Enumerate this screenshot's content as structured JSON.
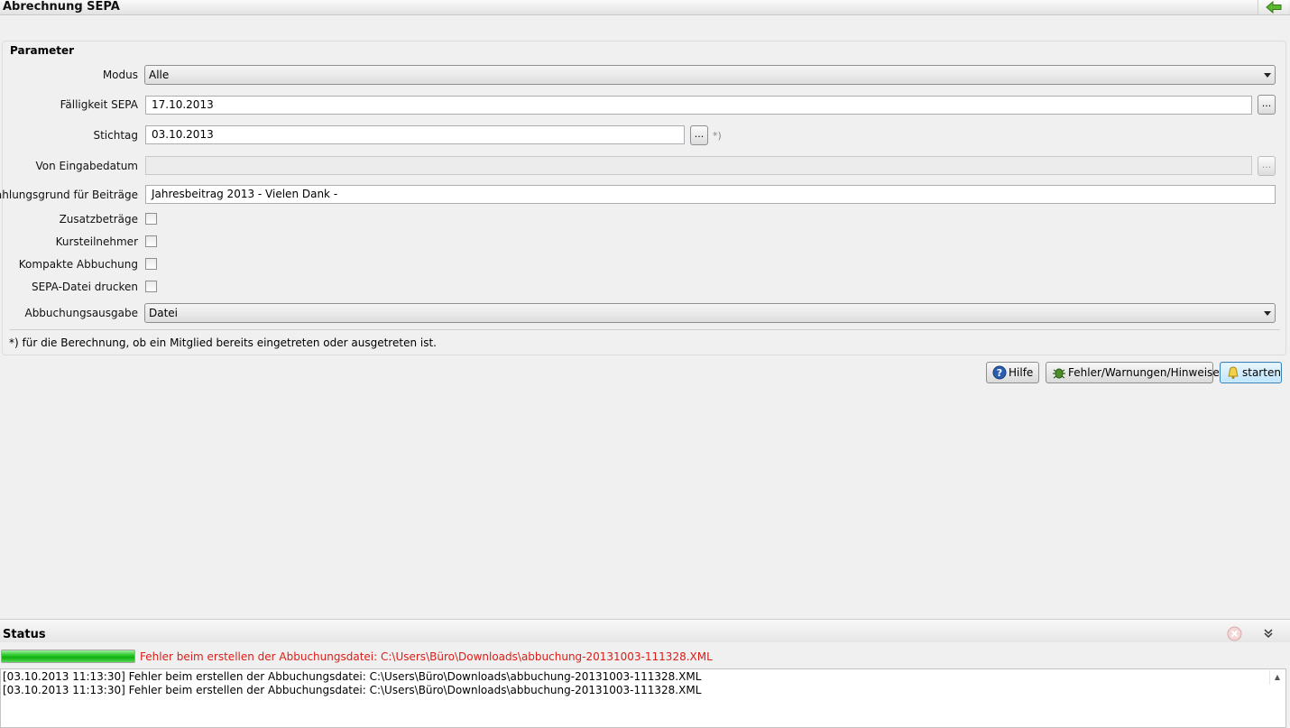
{
  "window": {
    "title": "Abrechnung SEPA",
    "back_icon": "arrow-left-icon"
  },
  "parameter": {
    "title": "Parameter",
    "modus": {
      "label": "Modus",
      "value": "Alle"
    },
    "faelligkeit": {
      "label": "Fälligkeit SEPA",
      "value": "17.10.2013",
      "button": "..."
    },
    "stichtag": {
      "label": "Stichtag",
      "value": "03.10.2013",
      "button": "...",
      "hint": "*)"
    },
    "von_eingabedatum": {
      "label": "Von Eingabedatum",
      "value": "",
      "button": "..."
    },
    "zahlungsgrund": {
      "label": "Zahlungsgrund für Beiträge",
      "value": "Jahresbeitrag 2013 -  Vielen Dank -"
    },
    "checkboxes": [
      {
        "label": "Zusatzbeträge",
        "checked": false
      },
      {
        "label": "Kursteilnehmer",
        "checked": false
      },
      {
        "label": "Kompakte Abbuchung",
        "checked": false
      },
      {
        "label": "SEPA-Datei drucken",
        "checked": false
      }
    ],
    "abbuchungsausgabe": {
      "label": "Abbuchungsausgabe",
      "value": "Datei"
    },
    "footnote": "*) für die Berechnung, ob ein Mitglied bereits eingetreten oder ausgetreten ist."
  },
  "actions": {
    "hilfe": "Hilfe",
    "fehler": "Fehler/Warnungen/Hinweise",
    "starten": "starten"
  },
  "status": {
    "title": "Status",
    "progress": 1.0,
    "message": "Fehler beim erstellen der Abbuchungsdatei: C:\\Users\\Büro\\Downloads\\abbuchung-20131003-111328.XML",
    "log": [
      "[03.10.2013 11:13:30] Fehler beim erstellen der Abbuchungsdatei: C:\\Users\\Büro\\Downloads\\abbuchung-20131003-111328.XML",
      "[03.10.2013 11:13:30] Fehler beim erstellen der Abbuchungsdatei: C:\\Users\\Büro\\Downloads\\abbuchung-20131003-111328.XML"
    ]
  },
  "colors": {
    "error_text": "#d91e18",
    "progress": "#10b010",
    "primary_button": "#bee6fd"
  }
}
